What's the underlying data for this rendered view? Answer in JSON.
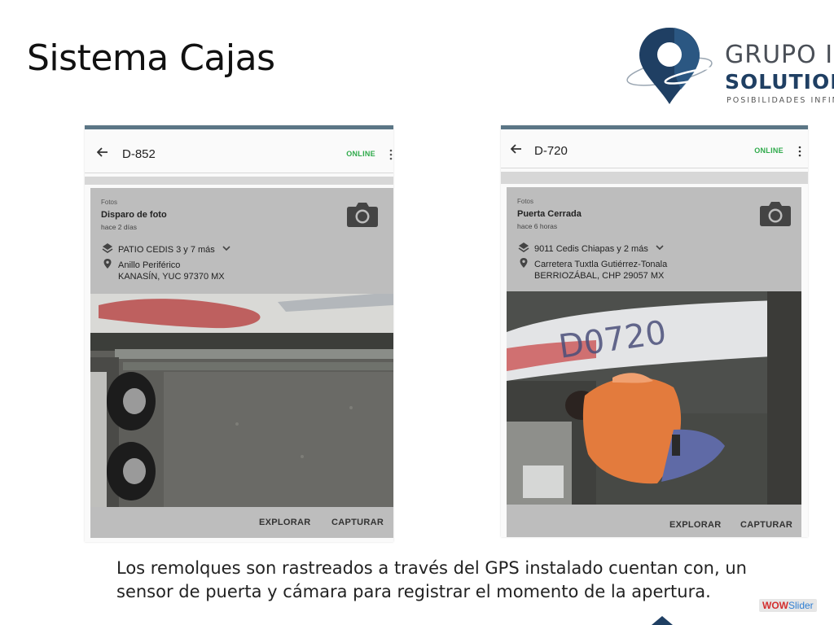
{
  "slide": {
    "title": "Sistema Cajas",
    "caption_line1": "Los remolques son rastreados a través del GPS instalado cuentan con, un",
    "caption_line2": "sensor de puerta y cámara para registrar el momento de la apertura."
  },
  "logo": {
    "line1": "GRUPO I",
    "line2": "SOLUTIONS",
    "line3": "POSIBILIDADES INFINI",
    "brand_color": "#1f3f63"
  },
  "phones": [
    {
      "unit": "D-852",
      "status": "ONLINE",
      "category": "Fotos",
      "event": "Disparo de foto",
      "time": "hace 2 días",
      "geofence": "PATIO CEDIS 3 y 7 más",
      "address1": "Anillo Periférico",
      "address2": "KANASÍN, YUC 97370 MX",
      "actions": {
        "explore": "EXPLORAR",
        "capture": "CAPTURAR"
      }
    },
    {
      "unit": "D-720",
      "status": "ONLINE",
      "category": "Fotos",
      "event": "Puerta Cerrada",
      "time": "hace 6 horas",
      "geofence": "9011 Cedis Chiapas y 2 más",
      "address1": "Carretera Tuxtla Gutiérrez-Tonala",
      "address2": "BERRIOZÁBAL, CHP 29057 MX",
      "trailer_number": "D0720",
      "actions": {
        "explore": "EXPLORAR",
        "capture": "CAPTURAR"
      }
    }
  ],
  "colors": {
    "online": "#2eaa4a",
    "phone_top_border": "#5b7686"
  },
  "watermark": {
    "part1": "WOW",
    "part2": "Slider"
  }
}
